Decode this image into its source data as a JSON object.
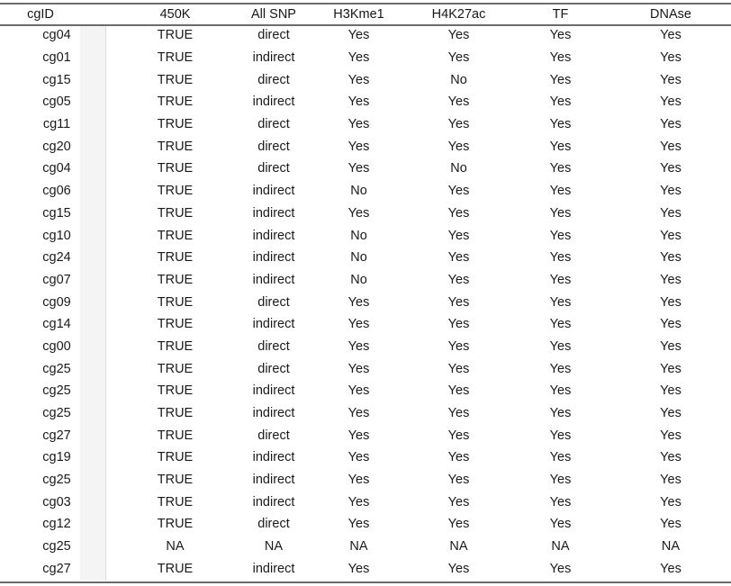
{
  "table": {
    "columns": [
      {
        "key": "cgid",
        "label": "cgID"
      },
      {
        "key": "k450",
        "label": "450K"
      },
      {
        "key": "allsnp",
        "label": "All SNP"
      },
      {
        "key": "h3kme1",
        "label": "H3Kme1"
      },
      {
        "key": "h4k27ac",
        "label": "H4K27ac"
      },
      {
        "key": "tf",
        "label": "TF"
      },
      {
        "key": "dnase",
        "label": "DNAse"
      }
    ],
    "row_count": 26,
    "rows": [
      {
        "cgid": "cg04",
        "k450": "TRUE",
        "allsnp": "direct",
        "h3kme1": "Yes",
        "h4k27ac": "Yes",
        "tf": "Yes",
        "dnase": "Yes"
      },
      {
        "cgid": "cg01",
        "k450": "TRUE",
        "allsnp": "indirect",
        "h3kme1": "Yes",
        "h4k27ac": "Yes",
        "tf": "Yes",
        "dnase": "Yes"
      },
      {
        "cgid": "cg15",
        "k450": "TRUE",
        "allsnp": "direct",
        "h3kme1": "Yes",
        "h4k27ac": "No",
        "tf": "Yes",
        "dnase": "Yes"
      },
      {
        "cgid": "cg05",
        "k450": "TRUE",
        "allsnp": "indirect",
        "h3kme1": "Yes",
        "h4k27ac": "Yes",
        "tf": "Yes",
        "dnase": "Yes"
      },
      {
        "cgid": "cg11",
        "k450": "TRUE",
        "allsnp": "direct",
        "h3kme1": "Yes",
        "h4k27ac": "Yes",
        "tf": "Yes",
        "dnase": "Yes"
      },
      {
        "cgid": "cg20",
        "k450": "TRUE",
        "allsnp": "direct",
        "h3kme1": "Yes",
        "h4k27ac": "Yes",
        "tf": "Yes",
        "dnase": "Yes"
      },
      {
        "cgid": "cg04",
        "k450": "TRUE",
        "allsnp": "direct",
        "h3kme1": "Yes",
        "h4k27ac": "No",
        "tf": "Yes",
        "dnase": "Yes"
      },
      {
        "cgid": "cg06",
        "k450": "TRUE",
        "allsnp": "indirect",
        "h3kme1": "No",
        "h4k27ac": "Yes",
        "tf": "Yes",
        "dnase": "Yes"
      },
      {
        "cgid": "cg15",
        "k450": "TRUE",
        "allsnp": "indirect",
        "h3kme1": "Yes",
        "h4k27ac": "Yes",
        "tf": "Yes",
        "dnase": "Yes"
      },
      {
        "cgid": "cg10",
        "k450": "TRUE",
        "allsnp": "indirect",
        "h3kme1": "No",
        "h4k27ac": "Yes",
        "tf": "Yes",
        "dnase": "Yes"
      },
      {
        "cgid": "cg24",
        "k450": "TRUE",
        "allsnp": "indirect",
        "h3kme1": "No",
        "h4k27ac": "Yes",
        "tf": "Yes",
        "dnase": "Yes"
      },
      {
        "cgid": "cg07",
        "k450": "TRUE",
        "allsnp": "indirect",
        "h3kme1": "No",
        "h4k27ac": "Yes",
        "tf": "Yes",
        "dnase": "Yes"
      },
      {
        "cgid": "cg09",
        "k450": "TRUE",
        "allsnp": "direct",
        "h3kme1": "Yes",
        "h4k27ac": "Yes",
        "tf": "Yes",
        "dnase": "Yes"
      },
      {
        "cgid": "cg14",
        "k450": "TRUE",
        "allsnp": "indirect",
        "h3kme1": "Yes",
        "h4k27ac": "Yes",
        "tf": "Yes",
        "dnase": "Yes"
      },
      {
        "cgid": "cg00",
        "k450": "TRUE",
        "allsnp": "direct",
        "h3kme1": "Yes",
        "h4k27ac": "Yes",
        "tf": "Yes",
        "dnase": "Yes"
      },
      {
        "cgid": "cg25",
        "k450": "TRUE",
        "allsnp": "direct",
        "h3kme1": "Yes",
        "h4k27ac": "Yes",
        "tf": "Yes",
        "dnase": "Yes"
      },
      {
        "cgid": "cg25",
        "k450": "TRUE",
        "allsnp": "indirect",
        "h3kme1": "Yes",
        "h4k27ac": "Yes",
        "tf": "Yes",
        "dnase": "Yes"
      },
      {
        "cgid": "cg25",
        "k450": "TRUE",
        "allsnp": "indirect",
        "h3kme1": "Yes",
        "h4k27ac": "Yes",
        "tf": "Yes",
        "dnase": "Yes"
      },
      {
        "cgid": "cg27",
        "k450": "TRUE",
        "allsnp": "direct",
        "h3kme1": "Yes",
        "h4k27ac": "Yes",
        "tf": "Yes",
        "dnase": "Yes"
      },
      {
        "cgid": "cg19",
        "k450": "TRUE",
        "allsnp": "indirect",
        "h3kme1": "Yes",
        "h4k27ac": "Yes",
        "tf": "Yes",
        "dnase": "Yes"
      },
      {
        "cgid": "cg25",
        "k450": "TRUE",
        "allsnp": "indirect",
        "h3kme1": "Yes",
        "h4k27ac": "Yes",
        "tf": "Yes",
        "dnase": "Yes"
      },
      {
        "cgid": "cg03",
        "k450": "TRUE",
        "allsnp": "indirect",
        "h3kme1": "Yes",
        "h4k27ac": "Yes",
        "tf": "Yes",
        "dnase": "Yes"
      },
      {
        "cgid": "cg12",
        "k450": "TRUE",
        "allsnp": "direct",
        "h3kme1": "Yes",
        "h4k27ac": "Yes",
        "tf": "Yes",
        "dnase": "Yes"
      },
      {
        "cgid": "cg25",
        "k450": "NA",
        "allsnp": "NA",
        "h3kme1": "NA",
        "h4k27ac": "NA",
        "tf": "NA",
        "dnase": "NA"
      },
      {
        "cgid": "cg27",
        "k450": "TRUE",
        "allsnp": "indirect",
        "h3kme1": "Yes",
        "h4k27ac": "Yes",
        "tf": "Yes",
        "dnase": "Yes"
      }
    ]
  },
  "colors": {
    "rule": "#6b6b6b",
    "text": "#1a1a1a",
    "occluder": "#f4f4f4",
    "page_background": "#ffffff"
  }
}
